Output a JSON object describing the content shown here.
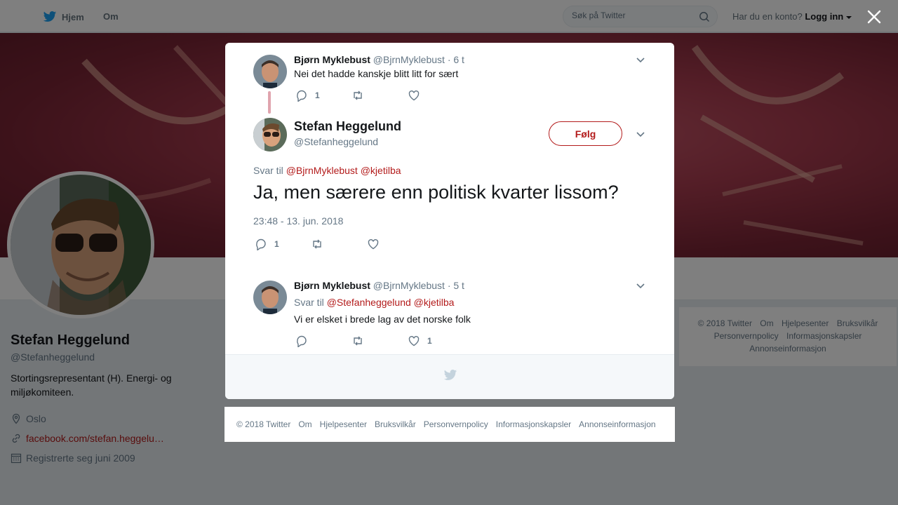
{
  "topbar": {
    "home_label": "Hjem",
    "about_label": "Om",
    "search_placeholder": "Søk på Twitter",
    "login_prompt": "Har du en konto?",
    "login_label": "Logg inn",
    "icons": [
      "twitter-bird-icon",
      "search-icon",
      "caret-down-icon",
      "close-icon"
    ]
  },
  "profile": {
    "name": "Stefan Heggelund",
    "handle": "@Stefanheggelund",
    "bio": "Stortingsrepresentant (H). Energi- og miljøkomiteen.",
    "location": "Oslo",
    "website": "facebook.com/stefan.heggelu…",
    "joined": "Registrerte seg juni 2009"
  },
  "sidebar_footer": {
    "links": [
      "© 2018 Twitter",
      "Om",
      "Hjelpesenter",
      "Bruksvilkår",
      "Personvernpolicy",
      "Informasjonskapsler",
      "Annonseinformasjon"
    ]
  },
  "modal": {
    "parent_tweet": {
      "name": "Bjørn Myklebust",
      "handle": "@BjrnMyklebust",
      "time": "· 6 t",
      "text": "Nei det hadde kanskje blitt litt for sært",
      "reply_count": "1"
    },
    "main_tweet": {
      "name": "Stefan Heggelund",
      "handle": "@Stefanheggelund",
      "follow_label": "Følg",
      "reply_prefix": "Svar til",
      "mention_1": "@BjrnMyklebust",
      "mention_2": "@kjetilba",
      "text": "Ja, men særere enn politisk kvarter lissom?",
      "timestamp": "23:48 - 13. jun. 2018",
      "reply_count": "1"
    },
    "reply_tweet": {
      "name": "Bjørn Myklebust",
      "handle": "@BjrnMyklebust",
      "time": "· 5 t",
      "reply_prefix": "Svar til",
      "mention_1": "@Stefanheggelund",
      "mention_2": "@kjetilba",
      "text": "Vi er elsket i brede lag av det norske folk",
      "like_count": "1"
    }
  },
  "bottom_footer": {
    "links": [
      "© 2018 Twitter",
      "Om",
      "Hjelpesenter",
      "Bruksvilkår",
      "Personvernpolicy",
      "Informasjonskapsler",
      "Annonseinformasjon"
    ]
  },
  "colors": {
    "accent": "#b31b1b",
    "text_secondary": "#657786",
    "twitter_blue": "#1da1f2"
  }
}
